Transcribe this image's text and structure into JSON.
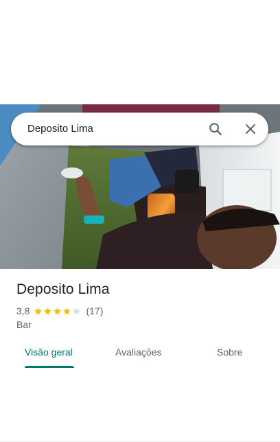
{
  "search": {
    "query": "Deposito Lima"
  },
  "photo": {
    "description_icon": "place-photo"
  },
  "place": {
    "name": "Deposito Lima",
    "rating": "3,8",
    "star_fraction": 0.76,
    "review_count": "(17)",
    "category": "Bar"
  },
  "tabs": [
    {
      "label": "Visão geral",
      "active": true
    },
    {
      "label": "Avaliações",
      "active": false
    },
    {
      "label": "Sobre",
      "active": false
    }
  ],
  "colors": {
    "accent": "#00796b",
    "star": "#fbbc04",
    "star_empty": "#dadce0",
    "text_primary": "#202124",
    "text_secondary": "#5f6368"
  },
  "icons": {
    "search": "search-icon",
    "close": "close-icon",
    "star": "star-icon"
  }
}
